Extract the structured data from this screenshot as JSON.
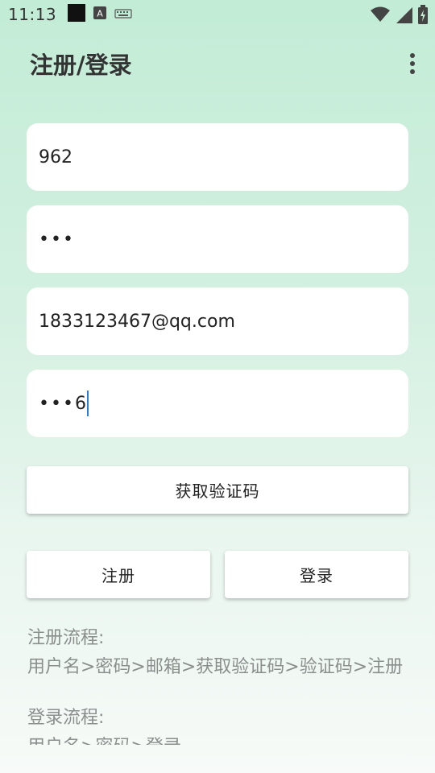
{
  "status": {
    "time": "11:13",
    "icons": [
      "square-notification-icon",
      "a-font-icon",
      "keyboard-icon",
      "wifi-icon",
      "signal-icon",
      "battery-charging-icon"
    ]
  },
  "app_bar": {
    "title": "注册/登录",
    "menu_icon": "more-vertical-icon"
  },
  "form": {
    "username": "962",
    "password_masked": "•••",
    "email": "1833123467@qq.com",
    "code_masked": "•••",
    "code_last_char": "6"
  },
  "buttons": {
    "get_code": "获取验证码",
    "register": "注册",
    "login": "登录"
  },
  "info": {
    "register_title": "注册流程:",
    "register_steps": "用户名>密码>邮箱>获取验证码>验证码>注册",
    "login_title": "登录流程:",
    "login_steps": "用户名>密码>登录"
  },
  "colors": {
    "background_top": "#c2ecd6",
    "caret": "#2a7fd6"
  }
}
